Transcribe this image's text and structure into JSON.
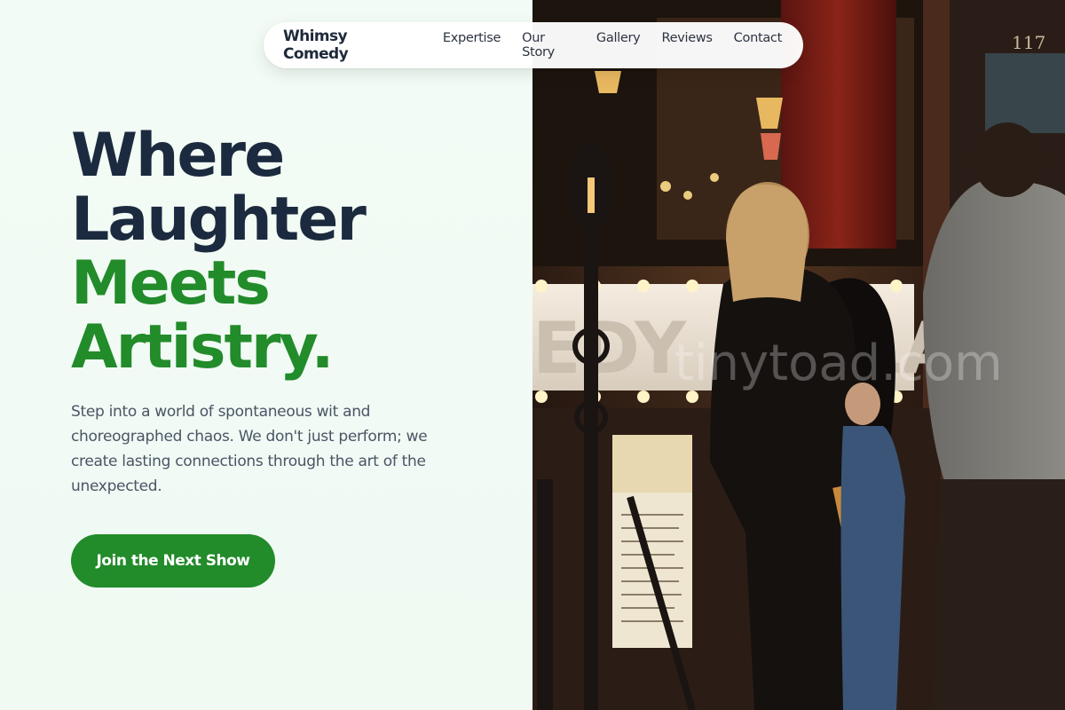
{
  "nav": {
    "brand": "Whimsy Comedy",
    "links": [
      "Expertise",
      "Our Story",
      "Gallery",
      "Reviews",
      "Contact"
    ]
  },
  "hero": {
    "title_line1": "Where",
    "title_line2": "Laughter",
    "title_line3": "Meets",
    "title_line4": "Artistry.",
    "subtitle": "Step into a world of spontaneous wit and choreographed chaos. We don't just perform; we create lasting connections through the art of the unexpected.",
    "cta_label": "Join the Next Show"
  },
  "photo": {
    "alt": "Comedy Cellar entrance at night",
    "sign_text": "EDY CELLAR",
    "watermark": "tinytoad.com",
    "door_number": "117"
  },
  "colors": {
    "accent": "#228b2a",
    "heading": "#1c2a3f",
    "body_text": "#4a5566",
    "background": "#f1fbf4"
  }
}
